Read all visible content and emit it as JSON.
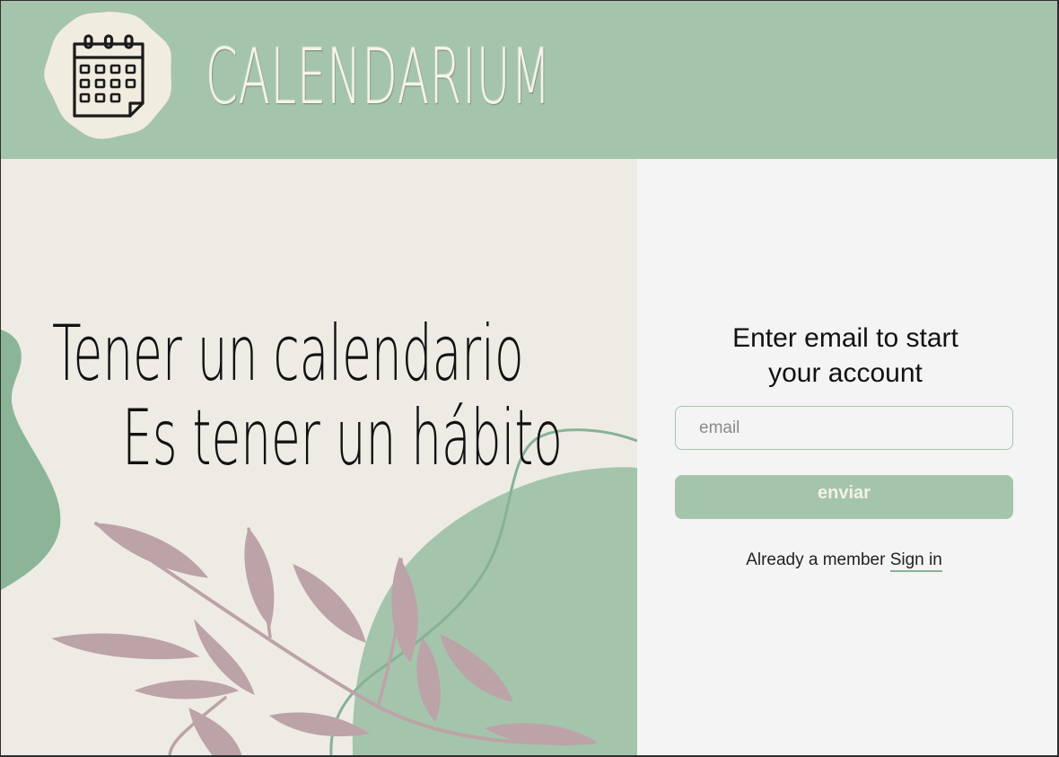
{
  "header": {
    "brand_name": "CALENDARIUM",
    "logo_icon": "calendar-icon",
    "background_color": "#a5c4ac"
  },
  "hero": {
    "tagline_line1": "Tener un calendario",
    "tagline_line2": "Es tener un hábito",
    "background_color": "#eeebe5",
    "decoration": [
      "green-blob-left",
      "green-blob-bottom",
      "curved-line",
      "leaf-branch"
    ]
  },
  "signup": {
    "title_line1": "Enter email to start",
    "title_line2": "your account",
    "email_placeholder": "email",
    "email_value": "",
    "submit_label": "enviar",
    "member_prompt": "Already a member",
    "signin_label": "Sign in",
    "accent_color": "#a5c4ac",
    "background_color": "#f4f4f4"
  }
}
